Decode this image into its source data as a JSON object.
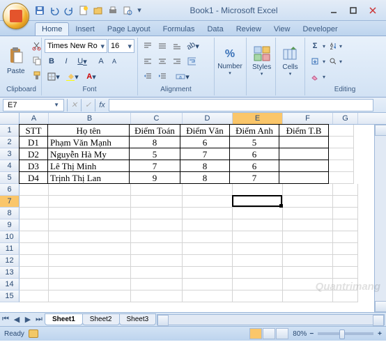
{
  "app": {
    "title": "Book1 - Microsoft Excel"
  },
  "qat": {
    "save": "save-icon",
    "undo": "undo-icon",
    "redo": "redo-icon",
    "new": "new-icon",
    "open": "open-icon",
    "print": "quick-print-icon",
    "preview": "print-preview-icon"
  },
  "tabs": [
    "Home",
    "Insert",
    "Page Layout",
    "Formulas",
    "Data",
    "Review",
    "View",
    "Developer"
  ],
  "active_tab": "Home",
  "ribbon": {
    "clipboard": {
      "label": "Clipboard",
      "paste": "Paste"
    },
    "font": {
      "label": "Font",
      "name": "Times New Ro",
      "size": "16",
      "bold": "B",
      "italic": "I",
      "underline": "U"
    },
    "alignment": {
      "label": "Alignment"
    },
    "number": {
      "label": "Number",
      "format": "%"
    },
    "styles": {
      "label": "Styles"
    },
    "cells": {
      "label": "Cells"
    },
    "editing": {
      "label": "Editing"
    }
  },
  "namebox": "E7",
  "formula": "",
  "columns": [
    "A",
    "B",
    "C",
    "D",
    "E",
    "F",
    "G"
  ],
  "col_widths": [
    "cA",
    "cB",
    "cC",
    "cD",
    "cE",
    "cF",
    "cG"
  ],
  "selected_col": "E",
  "selected_row": 7,
  "rows": [
    {
      "n": 1,
      "cells": [
        "STT",
        "Họ tên",
        "Điểm Toán",
        "Điểm Văn",
        "Điểm Anh",
        "Điểm T.B",
        ""
      ],
      "b": [
        1,
        1,
        1,
        1,
        1,
        1,
        0
      ],
      "align": [
        "",
        "",
        "",
        "",
        "",
        "",
        ""
      ]
    },
    {
      "n": 2,
      "cells": [
        "D1",
        "Phạm Văn Mạnh",
        "8",
        "6",
        "5",
        "",
        ""
      ],
      "b": [
        1,
        1,
        1,
        1,
        1,
        1,
        0
      ],
      "align": [
        "",
        "left",
        "",
        "",
        "",
        "",
        ""
      ]
    },
    {
      "n": 3,
      "cells": [
        "D2",
        "Nguyễn Hà My",
        "5",
        "7",
        "6",
        "",
        ""
      ],
      "b": [
        1,
        1,
        1,
        1,
        1,
        1,
        0
      ],
      "align": [
        "",
        "left",
        "",
        "",
        "",
        "",
        ""
      ]
    },
    {
      "n": 4,
      "cells": [
        "D3",
        "Lê Thị Minh",
        "7",
        "8",
        "6",
        "",
        ""
      ],
      "b": [
        1,
        1,
        1,
        1,
        1,
        1,
        0
      ],
      "align": [
        "",
        "left",
        "",
        "",
        "",
        "",
        ""
      ]
    },
    {
      "n": 5,
      "cells": [
        "D4",
        "Trịnh Thị Lan",
        "9",
        "8",
        "7",
        "",
        ""
      ],
      "b": [
        1,
        1,
        1,
        1,
        1,
        1,
        0
      ],
      "align": [
        "",
        "left",
        "",
        "",
        "",
        "",
        ""
      ]
    },
    {
      "n": 6,
      "cells": [
        "",
        "",
        "",
        "",
        "",
        "",
        ""
      ],
      "b": [
        0,
        0,
        0,
        0,
        0,
        0,
        0
      ],
      "align": [
        "",
        "",
        "",
        "",
        "",
        "",
        ""
      ]
    },
    {
      "n": 7,
      "cells": [
        "",
        "",
        "",
        "",
        "",
        "",
        ""
      ],
      "b": [
        0,
        0,
        0,
        0,
        0,
        0,
        0
      ],
      "align": [
        "",
        "",
        "",
        "",
        "",
        "",
        ""
      ]
    },
    {
      "n": 8,
      "cells": [
        "",
        "",
        "",
        "",
        "",
        "",
        ""
      ],
      "b": [
        0,
        0,
        0,
        0,
        0,
        0,
        0
      ],
      "align": [
        "",
        "",
        "",
        "",
        "",
        "",
        ""
      ]
    },
    {
      "n": 9,
      "cells": [
        "",
        "",
        "",
        "",
        "",
        "",
        ""
      ],
      "b": [
        0,
        0,
        0,
        0,
        0,
        0,
        0
      ],
      "align": [
        "",
        "",
        "",
        "",
        "",
        "",
        ""
      ]
    },
    {
      "n": 10,
      "cells": [
        "",
        "",
        "",
        "",
        "",
        "",
        ""
      ],
      "b": [
        0,
        0,
        0,
        0,
        0,
        0,
        0
      ],
      "align": [
        "",
        "",
        "",
        "",
        "",
        "",
        ""
      ]
    },
    {
      "n": 11,
      "cells": [
        "",
        "",
        "",
        "",
        "",
        "",
        ""
      ],
      "b": [
        0,
        0,
        0,
        0,
        0,
        0,
        0
      ],
      "align": [
        "",
        "",
        "",
        "",
        "",
        "",
        ""
      ]
    },
    {
      "n": 12,
      "cells": [
        "",
        "",
        "",
        "",
        "",
        "",
        ""
      ],
      "b": [
        0,
        0,
        0,
        0,
        0,
        0,
        0
      ],
      "align": [
        "",
        "",
        "",
        "",
        "",
        "",
        ""
      ]
    },
    {
      "n": 13,
      "cells": [
        "",
        "",
        "",
        "",
        "",
        "",
        ""
      ],
      "b": [
        0,
        0,
        0,
        0,
        0,
        0,
        0
      ],
      "align": [
        "",
        "",
        "",
        "",
        "",
        "",
        ""
      ]
    },
    {
      "n": 14,
      "cells": [
        "",
        "",
        "",
        "",
        "",
        "",
        ""
      ],
      "b": [
        0,
        0,
        0,
        0,
        0,
        0,
        0
      ],
      "align": [
        "",
        "",
        "",
        "",
        "",
        "",
        ""
      ]
    },
    {
      "n": 15,
      "cells": [
        "",
        "",
        "",
        "",
        "",
        "",
        ""
      ],
      "b": [
        0,
        0,
        0,
        0,
        0,
        0,
        0
      ],
      "align": [
        "",
        "",
        "",
        "",
        "",
        "",
        ""
      ]
    }
  ],
  "sheets": [
    "Sheet1",
    "Sheet2",
    "Sheet3"
  ],
  "active_sheet": "Sheet1",
  "status": {
    "ready": "Ready",
    "zoom": "80%"
  },
  "watermark": "Quantrimang"
}
